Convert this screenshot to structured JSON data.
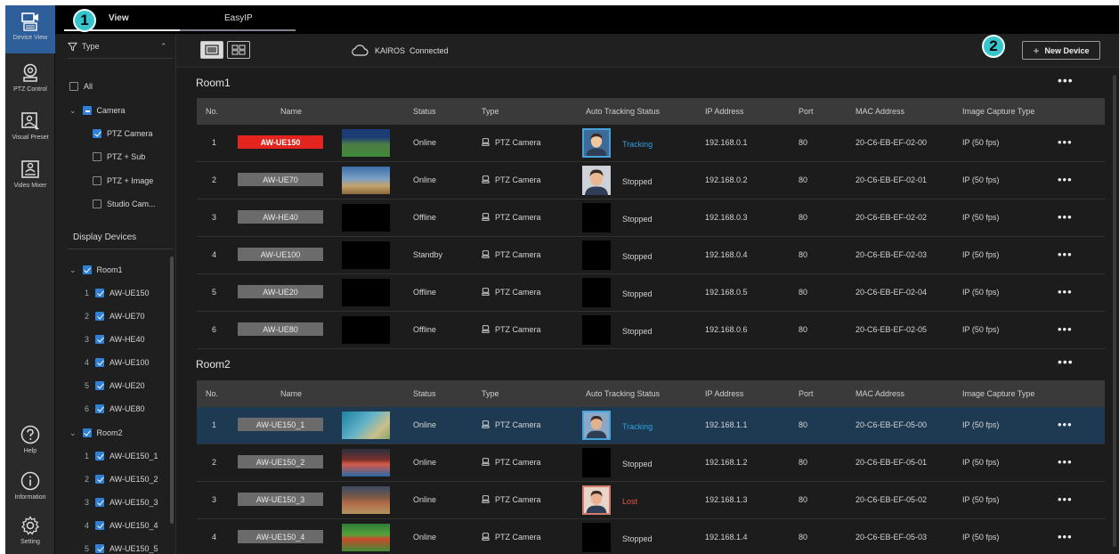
{
  "rail": {
    "device_view": "Device View",
    "ptz_control": "PTZ Control",
    "visual_preset": "Visual Preset",
    "video_mixer": "Video Mixer",
    "help": "Help",
    "information": "Information",
    "setting": "Setting"
  },
  "tabs": {
    "view": "View",
    "easyip": "EasyIP"
  },
  "filter": {
    "type_label": "Type",
    "all": "All",
    "camera": "Camera",
    "ptz_camera": "PTZ Camera",
    "ptz_sub": "PTZ + Sub",
    "ptz_image": "PTZ + Image",
    "studio_cam": "Studio Cam...",
    "display_devices": "Display Devices",
    "groups": [
      {
        "name": "Room1",
        "items": [
          {
            "num": "1",
            "name": "AW-UE150"
          },
          {
            "num": "2",
            "name": "AW-UE70"
          },
          {
            "num": "3",
            "name": "AW-HE40"
          },
          {
            "num": "4",
            "name": "AW-UE100"
          },
          {
            "num": "5",
            "name": "AW-UE20"
          },
          {
            "num": "6",
            "name": "AW-UE80"
          }
        ]
      },
      {
        "name": "Room2",
        "items": [
          {
            "num": "1",
            "name": "AW-UE150_1"
          },
          {
            "num": "2",
            "name": "AW-UE150_2"
          },
          {
            "num": "3",
            "name": "AW-UE150_3"
          },
          {
            "num": "4",
            "name": "AW-UE150_4"
          },
          {
            "num": "5",
            "name": "AW-UE150_5"
          }
        ]
      }
    ]
  },
  "toolbar": {
    "kairos": "KAIROS  Connected",
    "new_device": "New Device"
  },
  "badges": {
    "one": "1",
    "two": "2"
  },
  "more": "•••",
  "columns": {
    "no": "No.",
    "name": "Name",
    "status": "Status",
    "type": "Type",
    "auto_tracking": "Auto Tracking Status",
    "ip": "IP Address",
    "port": "Port",
    "mac": "MAC Address",
    "capture": "Image Capture Type"
  },
  "groups": [
    {
      "title": "Room1",
      "rows": [
        {
          "no": "1",
          "name": "AW-UE150",
          "status": "Online",
          "type": "PTZ Camera",
          "tracking": "Tracking",
          "ip": "192.168.0.1",
          "port": "80",
          "mac": "20-C6-EB-EF-02-00",
          "capture": "IP (50 fps)"
        },
        {
          "no": "2",
          "name": "AW-UE70",
          "status": "Online",
          "type": "PTZ Camera",
          "tracking": "Stopped",
          "ip": "192.168.0.2",
          "port": "80",
          "mac": "20-C6-EB-EF-02-01",
          "capture": "IP (50 fps)"
        },
        {
          "no": "3",
          "name": "AW-HE40",
          "status": "Offline",
          "type": "PTZ Camera",
          "tracking": "Stopped",
          "ip": "192.168.0.3",
          "port": "80",
          "mac": "20-C6-EB-EF-02-02",
          "capture": "IP (50 fps)"
        },
        {
          "no": "4",
          "name": "AW-UE100",
          "status": "Standby",
          "type": "PTZ Camera",
          "tracking": "Stopped",
          "ip": "192.168.0.4",
          "port": "80",
          "mac": "20-C6-EB-EF-02-03",
          "capture": "IP (50 fps)"
        },
        {
          "no": "5",
          "name": "AW-UE20",
          "status": "Offline",
          "type": "PTZ Camera",
          "tracking": "Stopped",
          "ip": "192.168.0.5",
          "port": "80",
          "mac": "20-C6-EB-EF-02-04",
          "capture": "IP (50 fps)"
        },
        {
          "no": "6",
          "name": "AW-UE80",
          "status": "Offline",
          "type": "PTZ Camera",
          "tracking": "Stopped",
          "ip": "192.168.0.6",
          "port": "80",
          "mac": "20-C6-EB-EF-02-05",
          "capture": "IP (50 fps)"
        }
      ]
    },
    {
      "title": "Room2",
      "rows": [
        {
          "no": "1",
          "name": "AW-UE150_1",
          "status": "Online",
          "type": "PTZ Camera",
          "tracking": "Tracking",
          "ip": "192.168.1.1",
          "port": "80",
          "mac": "20-C6-EB-EF-05-00",
          "capture": "IP (50 fps)"
        },
        {
          "no": "2",
          "name": "AW-UE150_2",
          "status": "Online",
          "type": "PTZ Camera",
          "tracking": "Stopped",
          "ip": "192.168.1.2",
          "port": "80",
          "mac": "20-C6-EB-EF-05-01",
          "capture": "IP (50 fps)"
        },
        {
          "no": "3",
          "name": "AW-UE150_3",
          "status": "Online",
          "type": "PTZ Camera",
          "tracking": "Lost",
          "ip": "192.168.1.3",
          "port": "80",
          "mac": "20-C6-EB-EF-05-02",
          "capture": "IP (50 fps)"
        },
        {
          "no": "4",
          "name": "AW-UE150_4",
          "status": "Online",
          "type": "PTZ Camera",
          "tracking": "Stopped",
          "ip": "192.168.1.4",
          "port": "80",
          "mac": "20-C6-EB-EF-05-03",
          "capture": "IP (50 fps)"
        }
      ]
    }
  ],
  "colors": {
    "accent": "#2f7fd4",
    "alert": "#e4251f",
    "tracking": "#2f9fe0",
    "lost": "#e05a46",
    "badge": "#37c5cd"
  }
}
